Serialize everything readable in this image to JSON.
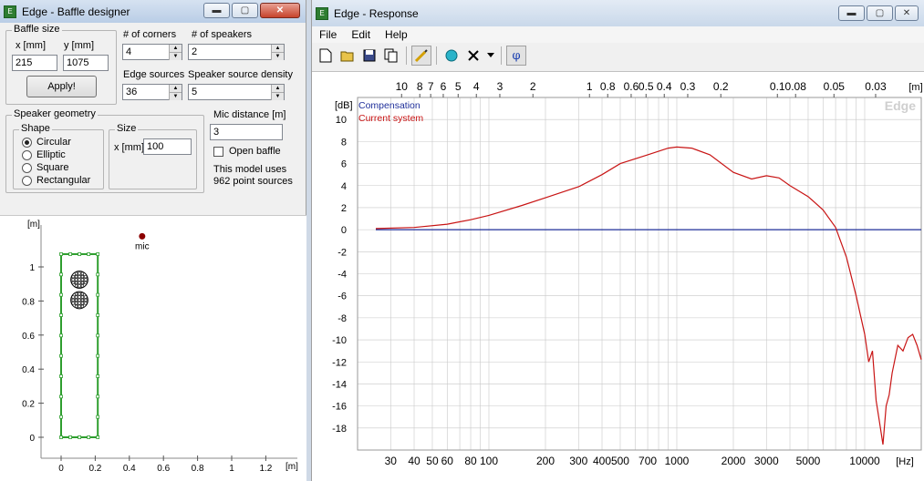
{
  "left_window": {
    "title": "Edge - Baffle designer",
    "baffle_size": {
      "legend": "Baffle size",
      "x_label": "x [mm]",
      "y_label": "y [mm]",
      "x_value": "215",
      "y_value": "1075",
      "apply_label": "Apply!"
    },
    "corners": {
      "label": "# of corners",
      "value": "4"
    },
    "speakers": {
      "label": "# of speakers",
      "value": "2"
    },
    "edge_sources": {
      "label": "Edge sources",
      "value": "36"
    },
    "speaker_density": {
      "label": "Speaker source density",
      "value": "5"
    },
    "geometry": {
      "legend": "Speaker geometry",
      "shape_legend": "Shape",
      "shapes": [
        "Circular",
        "Elliptic",
        "Square",
        "Rectangular"
      ],
      "selected_shape": "Circular",
      "size_legend": "Size",
      "size_label": "x [mm]",
      "size_value": "100"
    },
    "mic_distance": {
      "label": "Mic distance [m]",
      "value": "3"
    },
    "open_baffle_label": "Open baffle",
    "open_baffle_checked": false,
    "model_info_line1": "This model uses",
    "model_info_line2": "962 point sources",
    "plot": {
      "y_unit": "[m]",
      "x_unit": "[m]",
      "y_ticks": [
        "1",
        "0.8",
        "0.6",
        "0.4",
        "0.2",
        "0"
      ],
      "x_ticks": [
        "0",
        "0.2",
        "0.4",
        "0.6",
        "0.8",
        "1",
        "1.2"
      ],
      "mic_label": "mic",
      "baffle_width_m": 0.215,
      "baffle_height_m": 1.075,
      "speaker_centers_m": [
        [
          0.107,
          0.925
        ],
        [
          0.107,
          0.805
        ]
      ],
      "speaker_diameter_m": 0.1,
      "mic_position_m": [
        0.475,
        1.18
      ],
      "baffle_color": "#2e9e2e",
      "speaker_color": "#000000",
      "mic_color": "#8b0000"
    }
  },
  "right_window": {
    "title": "Edge - Response",
    "menu": [
      "File",
      "Edit",
      "Help"
    ],
    "toolbar_icons": [
      "new-document-icon",
      "open-folder-icon",
      "save-icon",
      "copy-icon",
      "draw-icon",
      "compensation-icon",
      "delete-icon",
      "dropdown-icon",
      "phase-icon"
    ],
    "phase_symbol": "φ",
    "watermark": "Edge",
    "colors": {
      "compensation": "#1f2f9a",
      "current": "#c81414",
      "grid": "#c8c8c8",
      "zero_line": "#1f2f9a"
    }
  },
  "chart_data": {
    "type": "line",
    "ylabel": "[dB]",
    "xlabel": "[Hz]",
    "top_axis_label": "[m]",
    "x_scale": "log",
    "xlim": [
      20,
      20000
    ],
    "ylim": [
      -20,
      12
    ],
    "y_ticks": [
      10,
      8,
      6,
      4,
      2,
      0,
      -2,
      -4,
      -6,
      -8,
      -10,
      -12,
      -14,
      -16,
      -18
    ],
    "x_ticks": [
      30,
      40,
      50,
      60,
      80,
      100,
      200,
      300,
      400,
      500,
      700,
      1000,
      2000,
      3000,
      5000,
      10000
    ],
    "x_tick_labels": [
      "30",
      "40",
      "50",
      "60",
      "80",
      "100",
      "200",
      "300",
      "400",
      "500",
      "700",
      "1000",
      "2000",
      "3000",
      "5000",
      "10000"
    ],
    "top_ticks": [
      "10",
      "8",
      "7",
      "6",
      "5",
      "4",
      "3",
      "2",
      "1",
      "0.8",
      "0.6",
      "0.5",
      "0.4",
      "0.3",
      "0.2",
      "0.1",
      "0.08",
      "0.05",
      "0.03"
    ],
    "grid": true,
    "legend": "top-left",
    "series": [
      {
        "name": "Compensation",
        "x": [
          25,
          20000
        ],
        "y": [
          0,
          0
        ]
      },
      {
        "name": "Current system",
        "x": [
          25,
          40,
          60,
          80,
          100,
          150,
          200,
          300,
          400,
          500,
          700,
          900,
          1000,
          1200,
          1500,
          2000,
          2500,
          3000,
          3500,
          4000,
          5000,
          6000,
          7000,
          8000,
          9000,
          10000,
          10500,
          11000,
          11500,
          12000,
          12500,
          13000,
          13500,
          14000,
          15000,
          16000,
          17000,
          18000,
          19000,
          20000
        ],
        "y": [
          0.1,
          0.2,
          0.5,
          0.9,
          1.3,
          2.2,
          2.9,
          3.9,
          5.0,
          6.0,
          6.8,
          7.4,
          7.5,
          7.4,
          6.8,
          5.2,
          4.6,
          4.9,
          4.7,
          4.0,
          3.0,
          1.8,
          0.2,
          -2.5,
          -6.0,
          -9.5,
          -12.0,
          -11.0,
          -15.5,
          -17.5,
          -19.5,
          -16.0,
          -15.0,
          -13.0,
          -10.5,
          -11.0,
          -9.8,
          -9.5,
          -10.5,
          -11.8
        ]
      }
    ]
  }
}
